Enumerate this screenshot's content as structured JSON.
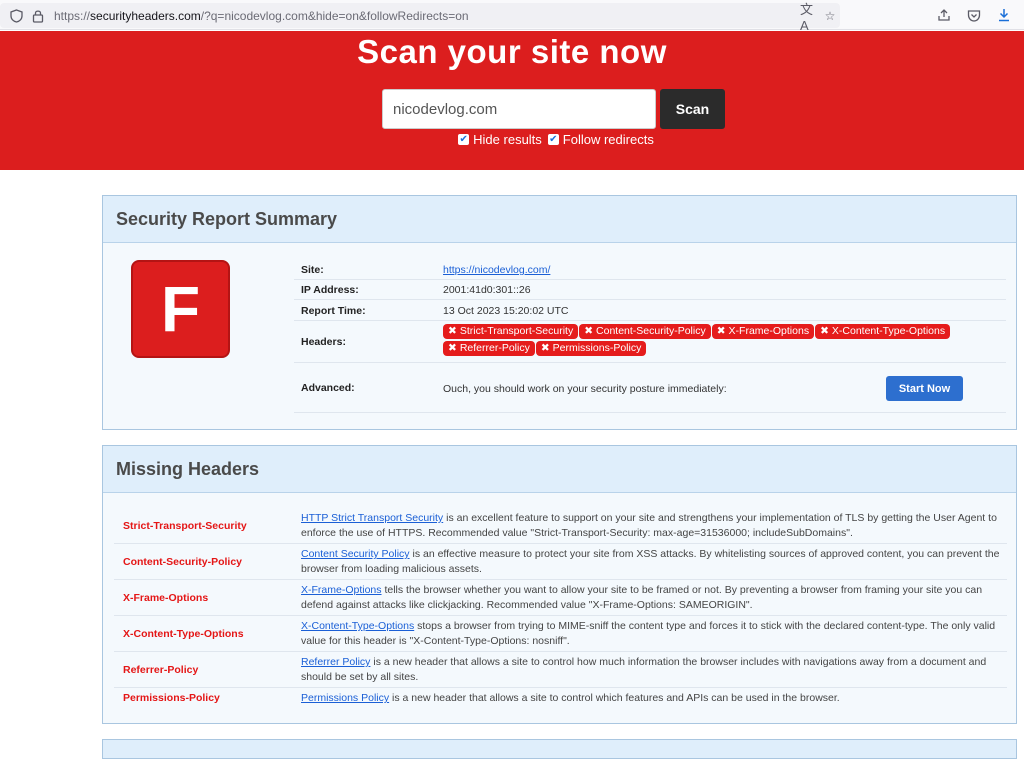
{
  "browser": {
    "url_prefix": "https://",
    "url_domain": "securityheaders.com",
    "url_rest": "/?q=nicodevlog.com&hide=on&followRedirects=on"
  },
  "hero": {
    "title": "Scan your site now",
    "input_value": "nicodevlog.com",
    "scan_label": "Scan",
    "hide_results_label": "Hide results",
    "follow_redirects_label": "Follow redirects"
  },
  "summary": {
    "heading": "Security Report Summary",
    "grade": "F",
    "site_label": "Site:",
    "site_value": "https://nicodevlog.com/",
    "ip_label": "IP Address:",
    "ip_value": "2001:41d0:301::26",
    "time_label": "Report Time:",
    "time_value": "13 Oct 2023 15:20:02 UTC",
    "headers_label": "Headers:",
    "headers": [
      "Strict-Transport-Security",
      "Content-Security-Policy",
      "X-Frame-Options",
      "X-Content-Type-Options",
      "Referrer-Policy",
      "Permissions-Policy"
    ],
    "advanced_label": "Advanced:",
    "advanced_text": "Ouch, you should work on your security posture immediately:",
    "start_now_label": "Start Now"
  },
  "missing": {
    "heading": "Missing Headers",
    "rows": [
      {
        "name": "Strict-Transport-Security",
        "link": "HTTP Strict Transport Security",
        "text": " is an excellent feature to support on your site and strengthens your implementation of TLS by getting the User Agent to enforce the use of HTTPS. Recommended value \"Strict-Transport-Security: max-age=31536000; includeSubDomains\"."
      },
      {
        "name": "Content-Security-Policy",
        "link": "Content Security Policy",
        "text": " is an effective measure to protect your site from XSS attacks. By whitelisting sources of approved content, you can prevent the browser from loading malicious assets."
      },
      {
        "name": "X-Frame-Options",
        "link": "X-Frame-Options",
        "text": " tells the browser whether you want to allow your site to be framed or not. By preventing a browser from framing your site you can defend against attacks like clickjacking. Recommended value \"X-Frame-Options: SAMEORIGIN\"."
      },
      {
        "name": "X-Content-Type-Options",
        "link": "X-Content-Type-Options",
        "text": " stops a browser from trying to MIME-sniff the content type and forces it to stick with the declared content-type. The only valid value for this header is \"X-Content-Type-Options: nosniff\"."
      },
      {
        "name": "Referrer-Policy",
        "link": "Referrer Policy",
        "text": " is a new header that allows a site to control how much information the browser includes with navigations away from a document and should be set by all sites."
      },
      {
        "name": "Permissions-Policy",
        "link": "Permissions Policy",
        "text": " is a new header that allows a site to control which features and APIs can be used in the browser."
      }
    ]
  },
  "colors": {
    "brand_red": "#dc1e1e",
    "panel_header": "#dfeefb",
    "link_blue": "#1a5fd6",
    "button_blue": "#2d6fcf"
  },
  "icons": [
    "shield-icon",
    "lock-icon",
    "translate-icon",
    "star-icon",
    "pocket-icon",
    "download-icon",
    "share-icon",
    "close-x-icon",
    "checkbox-checked-icon"
  ]
}
